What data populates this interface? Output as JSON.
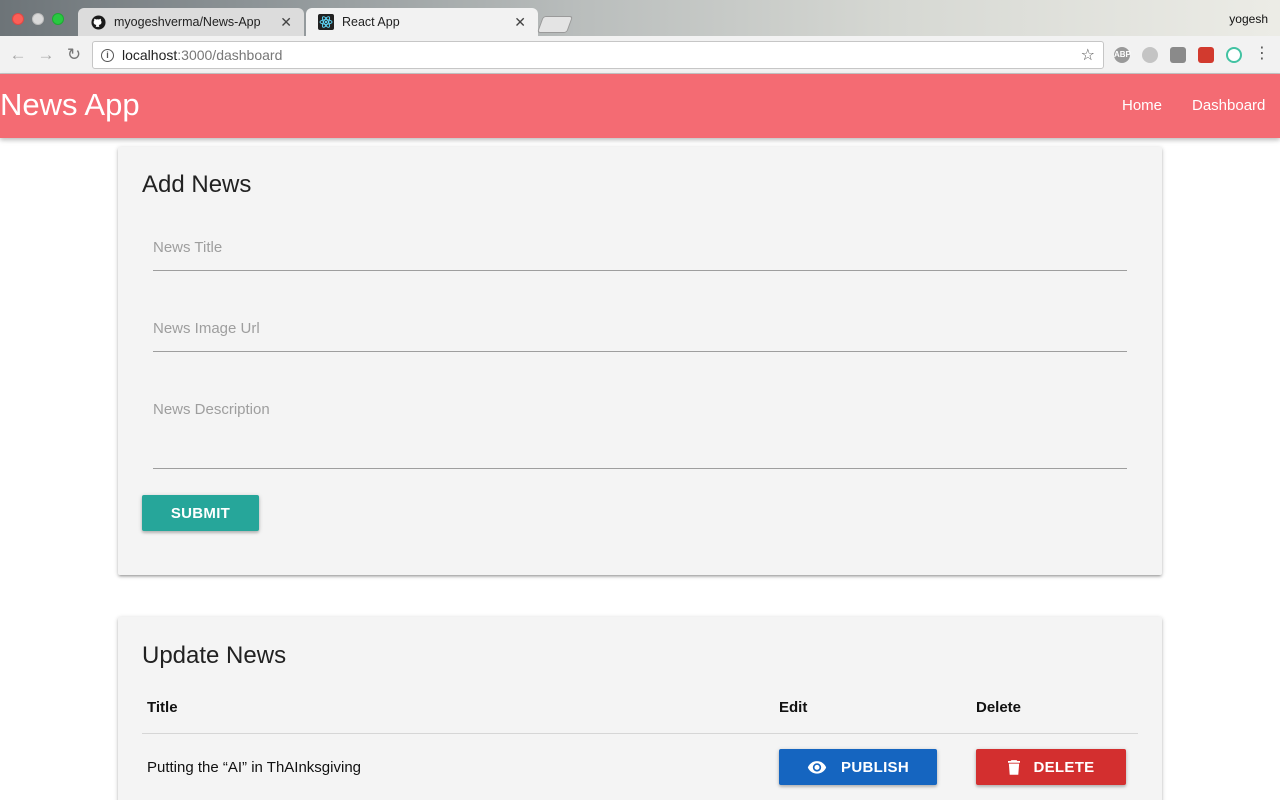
{
  "browser": {
    "tabs": [
      {
        "title": "myogeshverma/News-App",
        "favicon": "github-icon"
      },
      {
        "title": "React App",
        "favicon": "react-icon",
        "active": true
      }
    ],
    "profile": "yogesh",
    "url": {
      "host": "localhost",
      "path": ":3000/dashboard"
    }
  },
  "app": {
    "brand": "News App",
    "nav": {
      "home": "Home",
      "dashboard": "Dashboard"
    },
    "accent_color": "#f46b73"
  },
  "add_news": {
    "heading": "Add News",
    "fields": {
      "title_placeholder": "News Title",
      "image_placeholder": "News Image Url",
      "description_placeholder": "News Description"
    },
    "submit_label": "Submit"
  },
  "update_news": {
    "heading": "Update News",
    "columns": {
      "title": "Title",
      "edit": "Edit",
      "delete": "Delete"
    },
    "rows": [
      {
        "title": "Putting the “AI” in ThAInksgiving",
        "publish_label": "Publish",
        "delete_label": "Delete"
      }
    ]
  }
}
